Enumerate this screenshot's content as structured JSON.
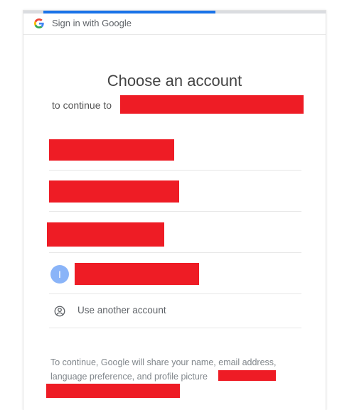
{
  "header": {
    "title": "Sign in with Google",
    "progress": 0.57
  },
  "main": {
    "title": "Choose an account",
    "subtitle": "to continue to",
    "accounts": [
      {
        "avatar_letter": ""
      },
      {
        "avatar_letter": ""
      },
      {
        "avatar_letter": ""
      },
      {
        "avatar_letter": "I"
      }
    ],
    "use_another_label": "Use another account",
    "footer_text": "To continue, Google will share your name, email address, language preference, and profile picture"
  },
  "colors": {
    "accent": "#1a73e8",
    "redaction": "#ee1c25",
    "avatar": "#8ab4f8"
  }
}
